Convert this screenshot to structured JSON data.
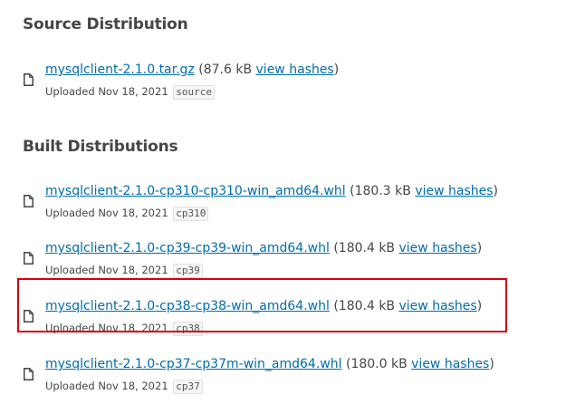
{
  "source": {
    "heading": "Source Distribution",
    "files": [
      {
        "filename": "mysqlclient-2.1.0.tar.gz",
        "open": " (",
        "size": "87.6 kB",
        "hashes": "view hashes",
        "close": ")",
        "uploaded": "Uploaded Nov 18, 2021",
        "tag": "source"
      }
    ]
  },
  "built": {
    "heading": "Built Distributions",
    "files": [
      {
        "filename": "mysqlclient-2.1.0-cp310-cp310-win_amd64.whl",
        "open": " (",
        "size": "180.3 kB",
        "hashes": "view hashes",
        "close": ")",
        "uploaded": "Uploaded Nov 18, 2021",
        "tag": "cp310"
      },
      {
        "filename": "mysqlclient-2.1.0-cp39-cp39-win_amd64.whl",
        "open": " (",
        "size": "180.4 kB",
        "hashes": "view hashes",
        "close": ")",
        "uploaded": "Uploaded Nov 18, 2021",
        "tag": "cp39"
      },
      {
        "filename": "mysqlclient-2.1.0-cp38-cp38-win_amd64.whl",
        "open": " (",
        "size": "180.4 kB",
        "hashes": "view hashes",
        "close": ")",
        "uploaded": "Uploaded Nov 18, 2021",
        "tag": "cp38"
      },
      {
        "filename": "mysqlclient-2.1.0-cp37-cp37m-win_amd64.whl",
        "open": " (",
        "size": "180.0 kB",
        "hashes": "view hashes",
        "close": ")",
        "uploaded": "Uploaded Nov 18, 2021",
        "tag": "cp37"
      }
    ]
  },
  "colors": {
    "link": "#006dad",
    "text": "#464646",
    "highlight": "#d7000d"
  },
  "icons": {
    "file": "file-icon"
  }
}
